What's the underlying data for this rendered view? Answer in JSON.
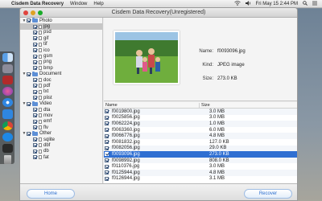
{
  "menubar": {
    "app_name": "Cisdem Data Recovery",
    "menus": [
      "Window",
      "Help"
    ],
    "clock": "Fri May 15  2:44 PM"
  },
  "window": {
    "title": "Cisdem Data Recovery(Unregistered)"
  },
  "sidebar": {
    "groups": [
      {
        "label": "Photo",
        "items": [
          "jpg",
          "psd",
          "gif",
          "tif",
          "ico",
          "gsm",
          "png",
          "bmp"
        ]
      },
      {
        "label": "Document",
        "items": [
          "doc",
          "pdf",
          "txt",
          "plist"
        ]
      },
      {
        "label": "Video",
        "items": [
          "dta",
          "mov",
          "emf",
          "flv"
        ]
      },
      {
        "label": "Other",
        "items": [
          "sqlite",
          "dbf",
          "db",
          "fat"
        ]
      }
    ],
    "selected": "jpg"
  },
  "preview": {
    "name_label": "Name:",
    "name_value": "f0093096.jpg",
    "kind_label": "Kind:",
    "kind_value": "JPEG image",
    "size_label": "Size:",
    "size_value": "273.0 KB"
  },
  "table": {
    "col_name": "Name",
    "col_size": "Size",
    "rows": [
      {
        "name": "f0019800.jpg",
        "size": "3.0 MB"
      },
      {
        "name": "f0025856.jpg",
        "size": "3.0 MB"
      },
      {
        "name": "f0062224.jpg",
        "size": "1.0 MB"
      },
      {
        "name": "f0063360.jpg",
        "size": "6.0 MB"
      },
      {
        "name": "f0066776.jpg",
        "size": "4.8 MB"
      },
      {
        "name": "f0081832.jpg",
        "size": "127.0 KB"
      },
      {
        "name": "f0082056.jpg",
        "size": "29.0 KB"
      },
      {
        "name": "f0093096.jpg",
        "size": "273.0 KB"
      },
      {
        "name": "f0098992.jpg",
        "size": "808.0 KB"
      },
      {
        "name": "f0110376.jpg",
        "size": "3.0 MB"
      },
      {
        "name": "f0125944.jpg",
        "size": "4.8 MB"
      },
      {
        "name": "f0126944.jpg",
        "size": "3.1 MB"
      }
    ],
    "selected_index": 7
  },
  "buttons": {
    "home": "Home",
    "recover": "Recover"
  },
  "colors": {
    "selection_blue": "#2f6fd2",
    "button_text": "#2d6fcf",
    "folder_blue": "#5d8fd6"
  }
}
